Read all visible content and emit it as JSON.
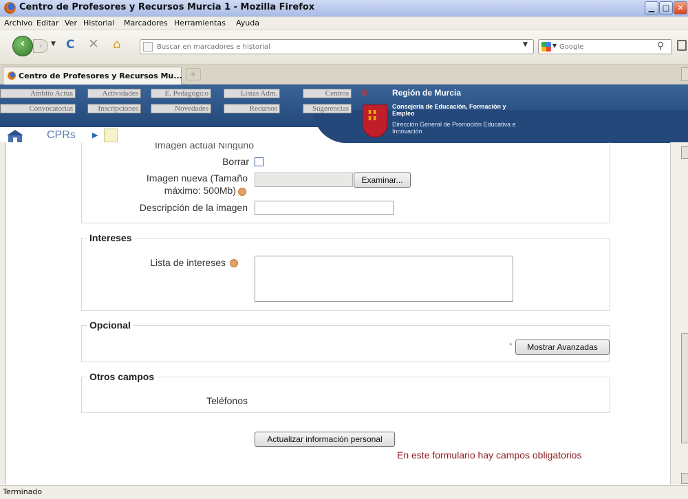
{
  "window": {
    "title": "Centro de Profesores y Recursos Murcia 1 - Mozilla Firefox",
    "min": "▁",
    "max": "□",
    "close": "✕"
  },
  "menu": [
    "Archivo",
    "Editar",
    "Ver",
    "Historial",
    "Marcadores",
    "Herramientas",
    "Ayuda"
  ],
  "nav": {
    "url_placeholder": "Buscar en marcadores e historial",
    "search_placeholder": "Google"
  },
  "tabs": [
    {
      "label": "Centro de Profesores y Recursos Mu..."
    }
  ],
  "site_nav": {
    "row1": [
      "Ambito Actua",
      "Actividades",
      "E. Pedagógico",
      "Listas Adm.",
      "Centros"
    ],
    "row2": [
      "Convocatorias",
      "Inscripciones",
      "Novedades",
      "Recursos",
      "Sugerencias"
    ]
  },
  "branding": {
    "region": "Región de Murcia",
    "consejeria": "Consejería de Educación, Formación y Empleo",
    "direccion": "Dirección General de Promoción Educativa e Innovación"
  },
  "breadcrumb": {
    "label": "CPRs"
  },
  "form": {
    "cut_label": "Imagen actual",
    "cut_value": "Ninguno",
    "borrar_label": "Borrar",
    "imagen_nueva_label_1": "Imagen nueva (Tamaño",
    "imagen_nueva_label_2": "máximo: 500Mb)",
    "examinar": "Examinar...",
    "descripcion_label": "Descripción de la imagen",
    "intereses_legend": "Intereses",
    "lista_intereses_label": "Lista de intereses",
    "opcional_legend": "Opcional",
    "mostrar_avanzadas": "Mostrar Avanzadas",
    "asterisk": "*",
    "otros_legend": "Otros campos",
    "telefonos_label": "Teléfonos",
    "submit": "Actualizar información personal",
    "required_note": "En este formulario hay campos obligatorios"
  },
  "status": "Terminado",
  "colors": {
    "header_blue": "#24487a",
    "required_red": "#8b1a1a"
  }
}
